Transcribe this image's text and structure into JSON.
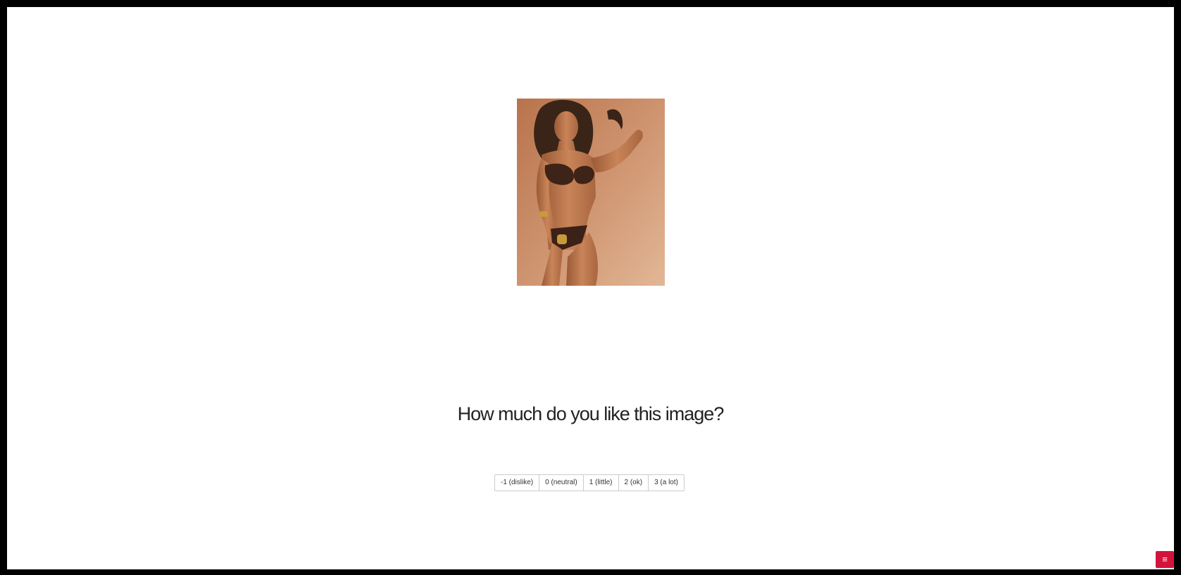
{
  "colors": {
    "frame_border": "#000000",
    "page_background": "#ffffff",
    "menu_button": "#d3133c"
  },
  "main": {
    "photo": {
      "icon": "photo"
    },
    "question": "How much do you like this image?",
    "ratings": [
      {
        "label": "-1 (dislike)"
      },
      {
        "label": "0 (neutral)"
      },
      {
        "label": "1 (little)"
      },
      {
        "label": "2 (ok)"
      },
      {
        "label": "3 (a lot)"
      }
    ]
  },
  "menu": {
    "icon": "hamburger-icon",
    "glyph": "≡"
  }
}
